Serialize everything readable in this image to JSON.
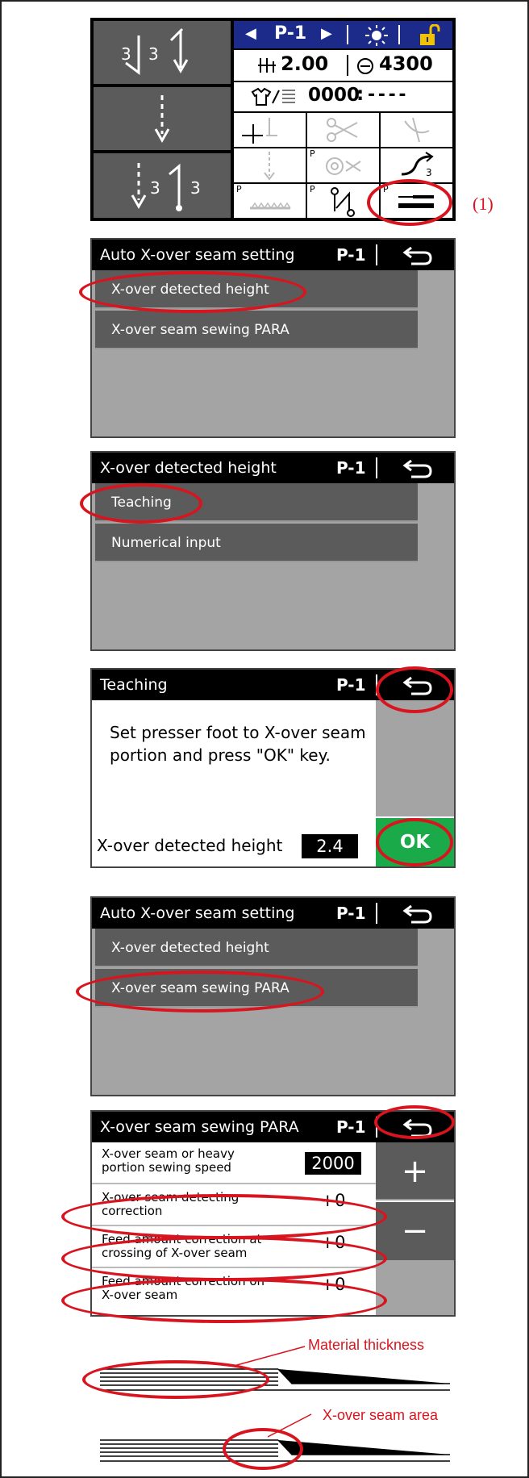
{
  "panel1": {
    "program": "P-1",
    "stitch_length": "2.00",
    "speed": "4300",
    "counter": "0000",
    "counter_dashes": "- - - -",
    "callout": "(1)",
    "left_keys": [
      {
        "name": "back-tack-start-icon",
        "numbers": [
          "3",
          "3"
        ]
      },
      {
        "name": "center-arrow-icon",
        "numbers": []
      },
      {
        "name": "back-tack-end-icon",
        "numbers": [
          "3",
          "3"
        ]
      }
    ],
    "icons": [
      "thread-trimmer-icon",
      "scissors-icon",
      "thread-wiper-icon",
      "needle-stop-icon",
      "thread-clamp-icon",
      "curve-icon",
      "feed-icon",
      "condensed-stitch-icon",
      "xover-seam-icon"
    ]
  },
  "panel2": {
    "title": "Auto X-over seam setting",
    "program": "P-1",
    "items": [
      "X-over detected height",
      "X-over seam sewing PARA"
    ]
  },
  "panel3": {
    "title": "X-over detected height",
    "program": "P-1",
    "items": [
      "Teaching",
      "Numerical input"
    ]
  },
  "panel4": {
    "title": "Teaching",
    "program": "P-1",
    "message": "Set presser foot to X-over seam portion and press \"OK\" key.",
    "height_label": "X-over detected height",
    "height_value": "2.4",
    "ok_label": "OK"
  },
  "panel5": {
    "title": "Auto X-over seam setting",
    "program": "P-1",
    "items": [
      "X-over detected height",
      "X-over seam sewing PARA"
    ]
  },
  "panel6": {
    "title": "X-over seam sewing PARA",
    "program": "P-1",
    "rows": [
      {
        "label": "X-over seam or heavy portion sewing speed",
        "value": "2000"
      },
      {
        "label": "X-over seam detecting correction",
        "value": "+0"
      },
      {
        "label": "Feed amount correction at crossing of X-over seam",
        "value": "+0"
      },
      {
        "label": "Feed amount correction on X-over seam",
        "value": "+0"
      }
    ],
    "plus": "+",
    "minus": "−"
  },
  "diagram": {
    "label_thickness": "Material thickness",
    "label_area": "X-over seam area"
  },
  "colors": {
    "highlight": "#d8141f",
    "navy": "#1c2a8a",
    "lock": "#f2c200",
    "ok_green": "#1aaa4a",
    "menu_gray": "#5b5b5b",
    "side_gray": "#a4a4a4"
  }
}
